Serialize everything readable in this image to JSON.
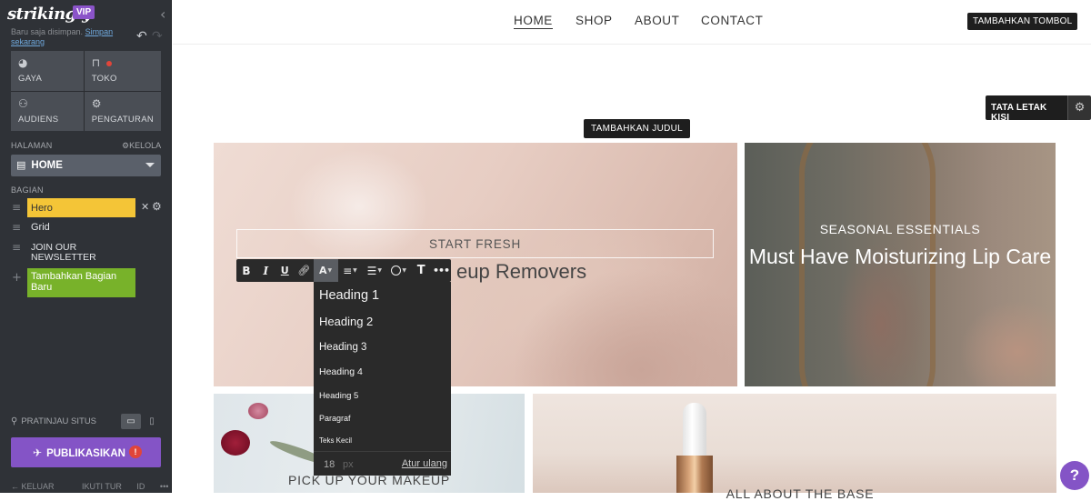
{
  "sidebar": {
    "brand": "strikingly",
    "badge": "VIP",
    "collapse_icon": "chevron-left-icon",
    "save_status": "Baru saja disimpan.",
    "save_link": "Simpan sekarang",
    "tiles": [
      {
        "label": "GAYA",
        "icon": "palette-icon"
      },
      {
        "label": "TOKO",
        "icon": "bag-icon"
      },
      {
        "label": "AUDIENS",
        "icon": "people-icon"
      },
      {
        "label": "PENGATURAN",
        "icon": "gear-icon"
      }
    ],
    "pages_label": "HALAMAN",
    "manage_label": "KELOLA",
    "current_page": "HOME",
    "sections_label": "BAGIAN",
    "sections": [
      "Hero",
      "Grid",
      "JOIN OUR NEWSLETTER"
    ],
    "add_section": "Tambahkan Bagian Baru",
    "preview_label": "PRATINJAU SITUS",
    "publish_label": "PUBLIKASIKAN",
    "publish_alert": "!",
    "footer": [
      "KELUAR",
      "IKUTI TUR",
      "ID",
      "•••"
    ]
  },
  "nav": {
    "items": [
      "HOME",
      "SHOP",
      "ABOUT",
      "CONTACT"
    ],
    "add_button": "TAMBAHKAN TOMBOL"
  },
  "canvas": {
    "grid_layout_label": "TATA LETAK KISI",
    "add_title_label": "TAMBAHKAN JUDUL",
    "main_block": {
      "subtitle": "START FRESH",
      "heading": "eup Removers"
    },
    "right_block": {
      "subtitle": "SEASONAL ESSENTIALS",
      "heading": "Must Have Moisturizing Lip Care"
    },
    "bottom_left_caption": "PICK UP YOUR MAKEUP",
    "bottom_right_caption": "ALL ABOUT THE BASE"
  },
  "toolbar": {
    "bold": "B",
    "italic": "I",
    "underline": "U",
    "text_size": "A",
    "text_tool": "T",
    "more": "•••"
  },
  "dropdown": {
    "options": [
      "Heading 1",
      "Heading 2",
      "Heading 3",
      "Heading 4",
      "Heading 5",
      "Paragraf",
      "Teks Kecil"
    ],
    "size_value": "18",
    "size_unit": "px",
    "reset_label": "Atur ulang"
  },
  "help_label": "?",
  "colors": {
    "sidebar_bg": "#2f3237",
    "accent_purple": "#8454c6",
    "hero_highlight": "#f4c537",
    "add_section_green": "#78b22a",
    "toolbar_bg": "#2a2a2a"
  }
}
